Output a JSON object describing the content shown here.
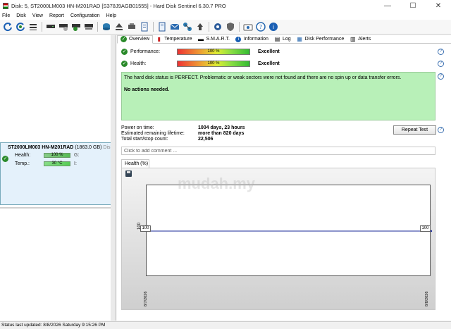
{
  "window": {
    "title": "Disk: 5, ST2000LM003 HN-M201RAD [S378J9AGB01555]  -  Hard Disk Sentinel 6.30.7 PRO",
    "minimize": "—",
    "maximize": "☐",
    "close": "✕"
  },
  "menu": {
    "items": [
      "File",
      "Disk",
      "View",
      "Report",
      "Configuration",
      "Help"
    ]
  },
  "disk_card": {
    "model": "ST2000LM003 HN-M201RAD",
    "size": "(1863.0 GB)",
    "disk_label": "Disk:",
    "health_label": "Health:",
    "health_value": "100 %",
    "health_extra": "G:",
    "temp_label": "Temp.:",
    "temp_value": "30 °C",
    "temp_extra": "I:"
  },
  "tabs": [
    "Overview",
    "Temperature",
    "S.M.A.R.T.",
    "Information",
    "Log",
    "Disk Performance",
    "Alerts"
  ],
  "performance": {
    "label": "Performance:",
    "percent": "100 %",
    "rating": "Excellent"
  },
  "health": {
    "label": "Health:",
    "percent": "100 %",
    "rating": "Excellent"
  },
  "message": {
    "text": "The hard disk status is PERFECT. Problematic or weak sectors were not found and there are no spin up or data transfer errors.",
    "action": "No actions needed."
  },
  "info": {
    "power_on_label": "Power on time:",
    "power_on_value": "1004 days, 23 hours",
    "remaining_label": "Estimated remaining lifetime:",
    "remaining_value": "more than 820 days",
    "startstop_label": "Total start/stop count:",
    "startstop_value": "22,506"
  },
  "repeat_test_label": "Repeat Test",
  "comment_placeholder": "Click to add comment ...",
  "chart_data": {
    "type": "line",
    "tab_label": "Health (%)",
    "x": [
      "8/7/2026",
      "8/8/2026"
    ],
    "series": [
      {
        "values": [
          100,
          100
        ]
      }
    ],
    "ylabel": "100",
    "ylim": [
      0,
      100
    ],
    "start_tag": "100",
    "end_tag": "100",
    "line_color": "#1a2a9a"
  },
  "statusbar": "Status last updated: 8/8/2026 Saturday 9:15:26 PM",
  "watermark": "mudah.my"
}
